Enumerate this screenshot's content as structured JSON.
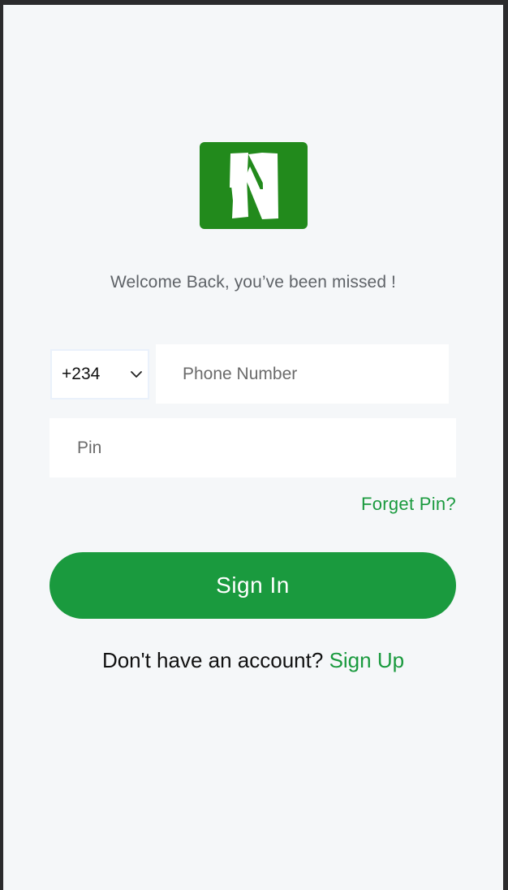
{
  "logo": {
    "icon": "n-logo-icon",
    "color": "#228a1c"
  },
  "welcome": {
    "text": "Welcome Back, you’ve been missed !"
  },
  "phone": {
    "country_code": "+234",
    "placeholder": "Phone Number",
    "value": ""
  },
  "pin": {
    "placeholder": "Pin",
    "value": ""
  },
  "forget_pin": {
    "label": "Forget Pin?"
  },
  "sign_in": {
    "label": "Sign In"
  },
  "sign_up": {
    "prompt": "Don't have an account?",
    "link": "Sign Up"
  },
  "colors": {
    "accent": "#1a9a3e",
    "background": "#f5f7f9"
  }
}
